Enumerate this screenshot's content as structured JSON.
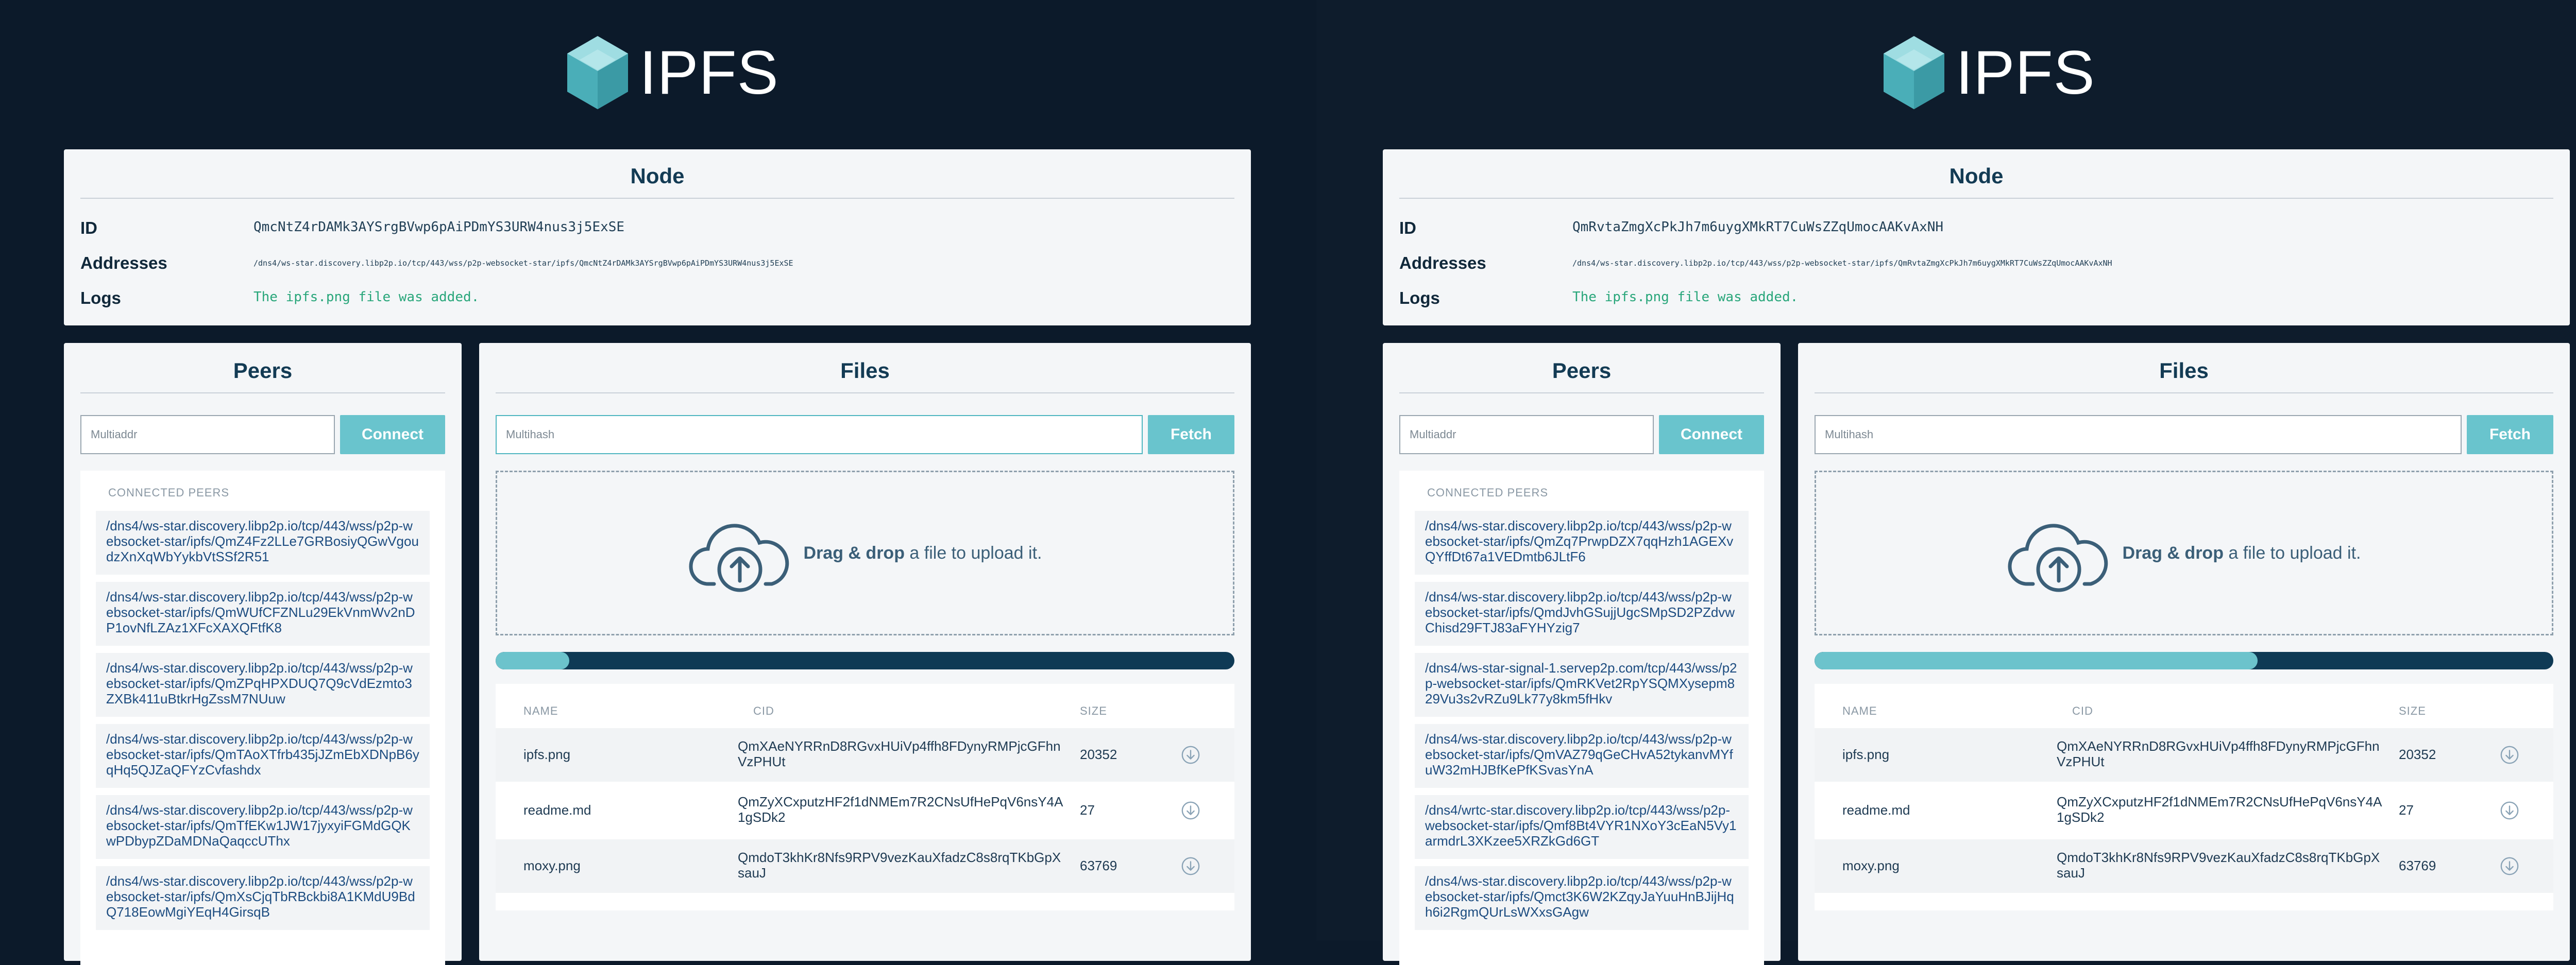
{
  "left": {
    "brand": "IPFS",
    "node": {
      "title": "Node",
      "id_label": "ID",
      "id_value": "QmcNtZ4rDAMk3AYSrgBVwp6pAiPDmYS3URW4nus3j5ExSE",
      "addresses_label": "Addresses",
      "addresses_value": "/dns4/ws-star.discovery.libp2p.io/tcp/443/wss/p2p-websocket-star/ipfs/QmcNtZ4rDAMk3AYSrgBVwp6pAiPDmYS3URW4nus3j5ExSE",
      "logs_label": "Logs",
      "logs_value": "The ipfs.png file was added."
    },
    "peers": {
      "title": "Peers",
      "input_placeholder": "Multiaddr",
      "connect_label": "Connect",
      "heading": "CONNECTED PEERS",
      "items": [
        "/dns4/ws-star.discovery.libp2p.io/tcp/443/wss/p2p-websocket-star/ipfs/QmZ4Fz2LLe7GRBosiyQGwVgoudzXnXqWbYykbVtSSf2R51",
        "/dns4/ws-star.discovery.libp2p.io/tcp/443/wss/p2p-websocket-star/ipfs/QmWUfCFZNLu29EkVnmWv2nDP1ovNfLZAz1XFcXAXQFtfK8",
        "/dns4/ws-star.discovery.libp2p.io/tcp/443/wss/p2p-websocket-star/ipfs/QmZPqHPXDUQ7Q9cVdEzmto3ZXBk411uBtkrHgZssM7NUuw",
        "/dns4/ws-star.discovery.libp2p.io/tcp/443/wss/p2p-websocket-star/ipfs/QmTAoXTfrb435jJZmEbXDNpB6yqHq5QJZaQFYzCvfashdx",
        "/dns4/ws-star.discovery.libp2p.io/tcp/443/wss/p2p-websocket-star/ipfs/QmTfEKw1JW17jyxyiFGMdGQKwPDbypZDaMDNaQaqccUThx",
        "/dns4/ws-star.discovery.libp2p.io/tcp/443/wss/p2p-websocket-star/ipfs/QmXsCjqTbRBckbi8A1KMdU9BdQ718EowMgiYEqH4GirsqB"
      ]
    },
    "files": {
      "title": "Files",
      "input_placeholder": "Multihash",
      "fetch_label": "Fetch",
      "drop_bold": "Drag & drop",
      "drop_rest": " a file to upload it.",
      "progress": 0.1,
      "col_name": "NAME",
      "col_cid": "CID",
      "col_size": "SIZE",
      "rows": [
        {
          "name": "ipfs.png",
          "cid": "QmXAeNYRRnD8RGvxHUiVp4ffh8FDynyRMPjcGFhnVzPHUt",
          "size": "20352"
        },
        {
          "name": "readme.md",
          "cid": "QmZyXCxputzHF2f1dNMEm7R2CNsUfHePqV6nsY4A1gSDk2",
          "size": "27"
        },
        {
          "name": "moxy.png",
          "cid": "QmdoT3khKr8Nfs9RPV9vezKauXfadzC8s8rqTKbGpXsauJ",
          "size": "63769"
        }
      ]
    }
  },
  "right": {
    "brand": "IPFS",
    "node": {
      "title": "Node",
      "id_label": "ID",
      "id_value": "QmRvtaZmgXcPkJh7m6uygXMkRT7CuWsZZqUmocAAKvAxNH",
      "addresses_label": "Addresses",
      "addresses_value": "/dns4/ws-star.discovery.libp2p.io/tcp/443/wss/p2p-websocket-star/ipfs/QmRvtaZmgXcPkJh7m6uygXMkRT7CuWsZZqUmocAAKvAxNH",
      "logs_label": "Logs",
      "logs_value": "The ipfs.png file was added."
    },
    "peers": {
      "title": "Peers",
      "input_placeholder": "Multiaddr",
      "connect_label": "Connect",
      "heading": "CONNECTED PEERS",
      "items": [
        "/dns4/ws-star.discovery.libp2p.io/tcp/443/wss/p2p-websocket-star/ipfs/QmZq7PrwpDZX7qqHzh1AGEXvQYffDt67a1VEDmtb6JLtF6",
        "/dns4/ws-star.discovery.libp2p.io/tcp/443/wss/p2p-websocket-star/ipfs/QmdJvhGSujjUgcSMpSD2PZdvwChisd29FTJ83aFYHYzig7",
        "/dns4/ws-star-signal-1.servep2p.com/tcp/443/wss/p2p-websocket-star/ipfs/QmRKVet2RpYSQMXysepm829Vu3s2vRZu9Lk77y8km5fHkv",
        "/dns4/ws-star.discovery.libp2p.io/tcp/443/wss/p2p-websocket-star/ipfs/QmVAZ79qGeCHvA52tykanvMYfuW32mHJBfKePfKSvasYnA",
        "/dns4/wrtc-star.discovery.libp2p.io/tcp/443/wss/p2p-websocket-star/ipfs/Qmf8Bt4VYR1NXoY3cEaN5Vy1armdrL3XKzee5XRZkGd6GT",
        "/dns4/ws-star.discovery.libp2p.io/tcp/443/wss/p2p-websocket-star/ipfs/Qmct3K6W2KZqyJaYuuHnBJijHqh6i2RgmQUrLsWXxsGAgw"
      ]
    },
    "files": {
      "title": "Files",
      "input_placeholder": "Multihash",
      "fetch_label": "Fetch",
      "drop_bold": "Drag & drop",
      "drop_rest": " a file to upload it.",
      "progress": 0.6,
      "col_name": "NAME",
      "col_cid": "CID",
      "col_size": "SIZE",
      "rows": [
        {
          "name": "ipfs.png",
          "cid": "QmXAeNYRRnD8RGvxHUiVp4ffh8FDynyRMPjcGFhnVzPHUt",
          "size": "20352"
        },
        {
          "name": "readme.md",
          "cid": "QmZyXCxputzHF2f1dNMEm7R2CNsUfHePqV6nsY4A1gSDk2",
          "size": "27"
        },
        {
          "name": "moxy.png",
          "cid": "QmdoT3khKr8Nfs9RPV9vezKauXfadzC8s8rqTKbGpXsauJ",
          "size": "63769"
        }
      ]
    }
  },
  "icons": {
    "logo": "ipfs-cube-logo",
    "upload": "cloud-upload-icon",
    "download": "download-circle-icon"
  },
  "colors": {
    "background": "#0c1a2a",
    "accent": "#69c4cd",
    "progress_track": "#0f3a55",
    "log_text": "#28a67a",
    "peer_link": "#1c4c80"
  }
}
